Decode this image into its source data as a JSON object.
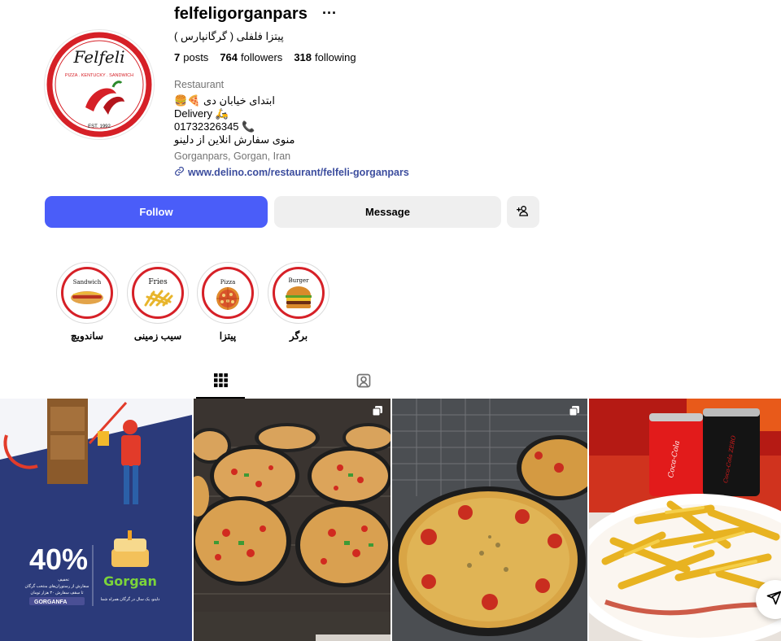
{
  "profile": {
    "username": "felfeligorganpars",
    "more_label": "···",
    "full_name": "پیتزا فلفلی ( گرگانپارس )",
    "posts_count": "7",
    "posts_label": "posts",
    "followers_count": "764",
    "followers_label": "followers",
    "following_count": "318",
    "following_label": "following",
    "category": "Restaurant",
    "bio_line1": "ابتدای خیابان دی 🍕🍔",
    "bio_line2": "Delivery 🛵",
    "bio_line3": "01732326345 📞",
    "bio_line4": "منوی سفارش انلاین از دلینو",
    "location": "Gorganpars, Gorgan, Iran",
    "website": "www.delino.com/restaurant/felfeli-gorganpars"
  },
  "avatar": {
    "brand": "Felfeli",
    "tagline": "PIZZA . KENTUCKY . SANDWICH",
    "est": "EST. 1992"
  },
  "actions": {
    "follow_label": "Follow",
    "message_label": "Message"
  },
  "highlights": [
    {
      "title": "Sandwich",
      "caption": "ساندویچ"
    },
    {
      "title": "Fries",
      "caption": "سیب زمینی"
    },
    {
      "title": "Pizza",
      "caption": "پیتزا"
    },
    {
      "title": "Burger",
      "caption": "برگر"
    }
  ],
  "posts": {
    "promo": {
      "discount": "40%",
      "discount_sub": "تخفیف",
      "brand": "Gorgan",
      "code": "GORGANFA",
      "line1": "سفارش از رستوران‌های منتخب گرگان",
      "line2": "تا سقف سفارش ۳۰ هزار تومان",
      "footer": "دلینو، یک سال در گرگان همراه شما"
    },
    "drink_label_1": "Coca-Cola",
    "drink_label_2": "Coca-Cola ZERO"
  },
  "colors": {
    "follow_blue": "#4a5df9",
    "brand_red": "#d62027",
    "promo_navy": "#2b3a7a",
    "link_blue": "#3c4d9e"
  },
  "icons": [
    "more-icon",
    "link-icon",
    "add-person-icon",
    "grid-icon",
    "tagged-icon",
    "multiple-posts-icon",
    "share-icon"
  ]
}
